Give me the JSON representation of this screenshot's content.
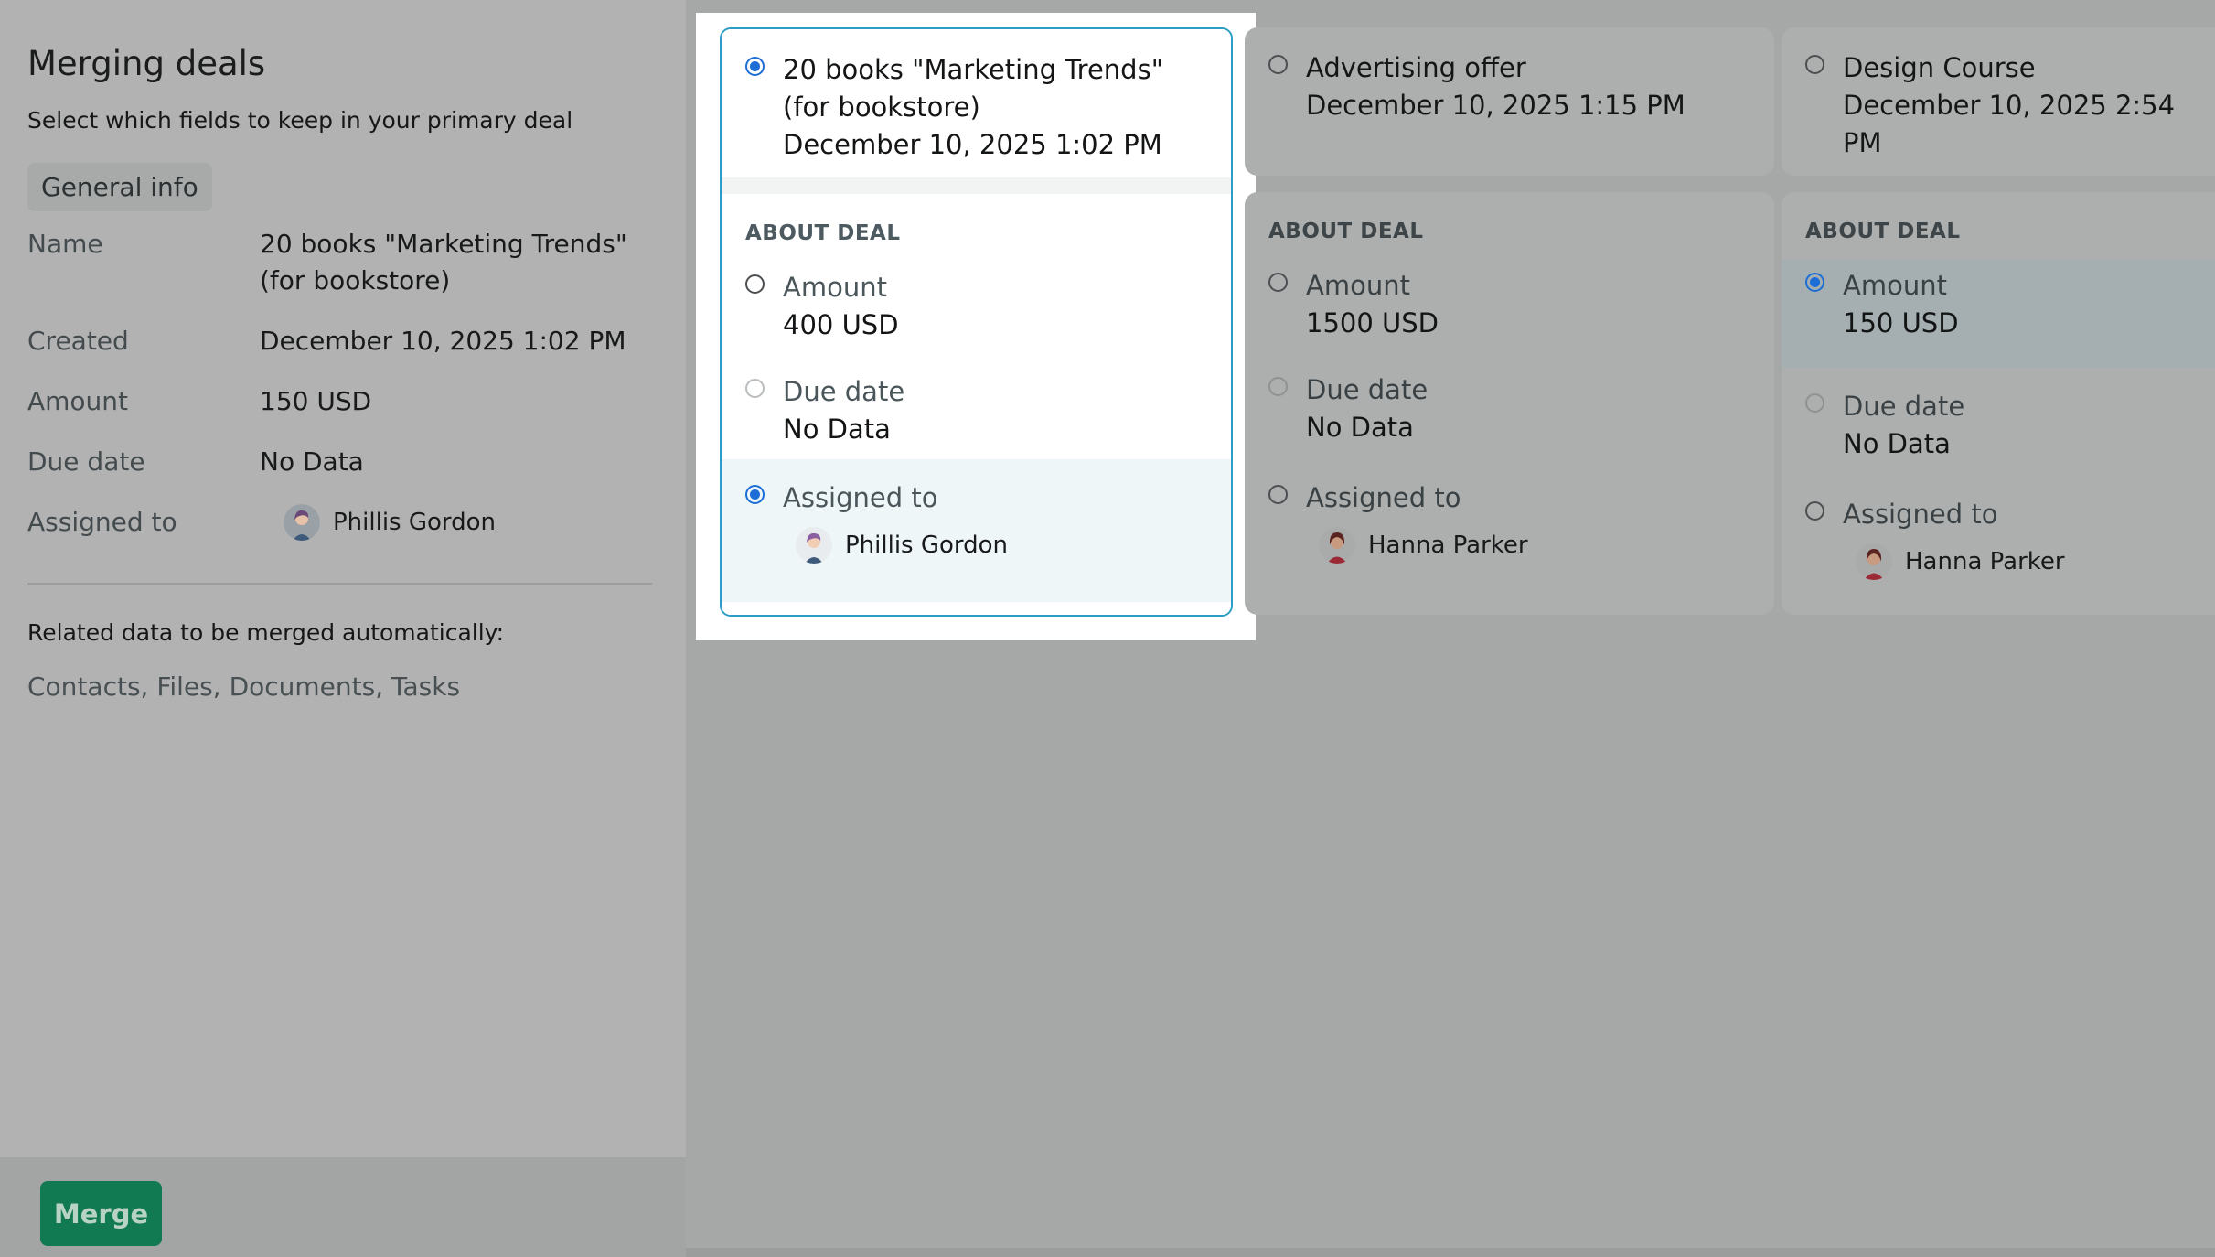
{
  "page": {
    "title": "Merging deals",
    "subtitle": "Select which fields to keep in your primary deal",
    "section_chip": "General info"
  },
  "summary": {
    "rows": [
      {
        "key": "Name",
        "value": "20 books \"Marketing Trends\" (for bookstore)"
      },
      {
        "key": "Created",
        "value": "December 10, 2025 1:02 PM"
      },
      {
        "key": "Amount",
        "value": "150 USD"
      },
      {
        "key": "Due date",
        "value": "No Data"
      },
      {
        "key": "Assigned to",
        "value": "Phillis Gordon"
      }
    ],
    "related_label": "Related data to be merged automatically:",
    "related_value": "Contacts, Files, Documents, Tasks"
  },
  "actions": {
    "merge_label": "Merge"
  },
  "deals": [
    {
      "title": "20 books \"Marketing Trends\" (for bookstore)",
      "created": "December 10, 2025 1:02 PM",
      "selected": true,
      "section_label": "ABOUT DEAL",
      "amount_label": "Amount",
      "amount_value": "400 USD",
      "amount_selected": false,
      "due_label": "Due date",
      "due_value": "No Data",
      "assigned_label": "Assigned to",
      "assigned_value": "Phillis Gordon",
      "assigned_selected": true
    },
    {
      "title": "Advertising offer",
      "created": "December 10, 2025 1:15 PM",
      "selected": false,
      "section_label": "ABOUT DEAL",
      "amount_label": "Amount",
      "amount_value": "1500 USD",
      "amount_selected": false,
      "due_label": "Due date",
      "due_value": "No Data",
      "assigned_label": "Assigned to",
      "assigned_value": "Hanna Parker",
      "assigned_selected": false
    },
    {
      "title": "Design Course",
      "created": "December 10, 2025 2:54 PM",
      "selected": false,
      "section_label": "ABOUT DEAL",
      "amount_label": "Amount",
      "amount_value": "150 USD",
      "amount_selected": true,
      "due_label": "Due date",
      "due_value": "No Data",
      "assigned_label": "Assigned to",
      "assigned_value": "Hanna Parker",
      "assigned_selected": false
    }
  ],
  "colors": {
    "accent": "#1c6ed6",
    "merge_button": "#127a52",
    "highlight_border": "#2a9ec7"
  }
}
